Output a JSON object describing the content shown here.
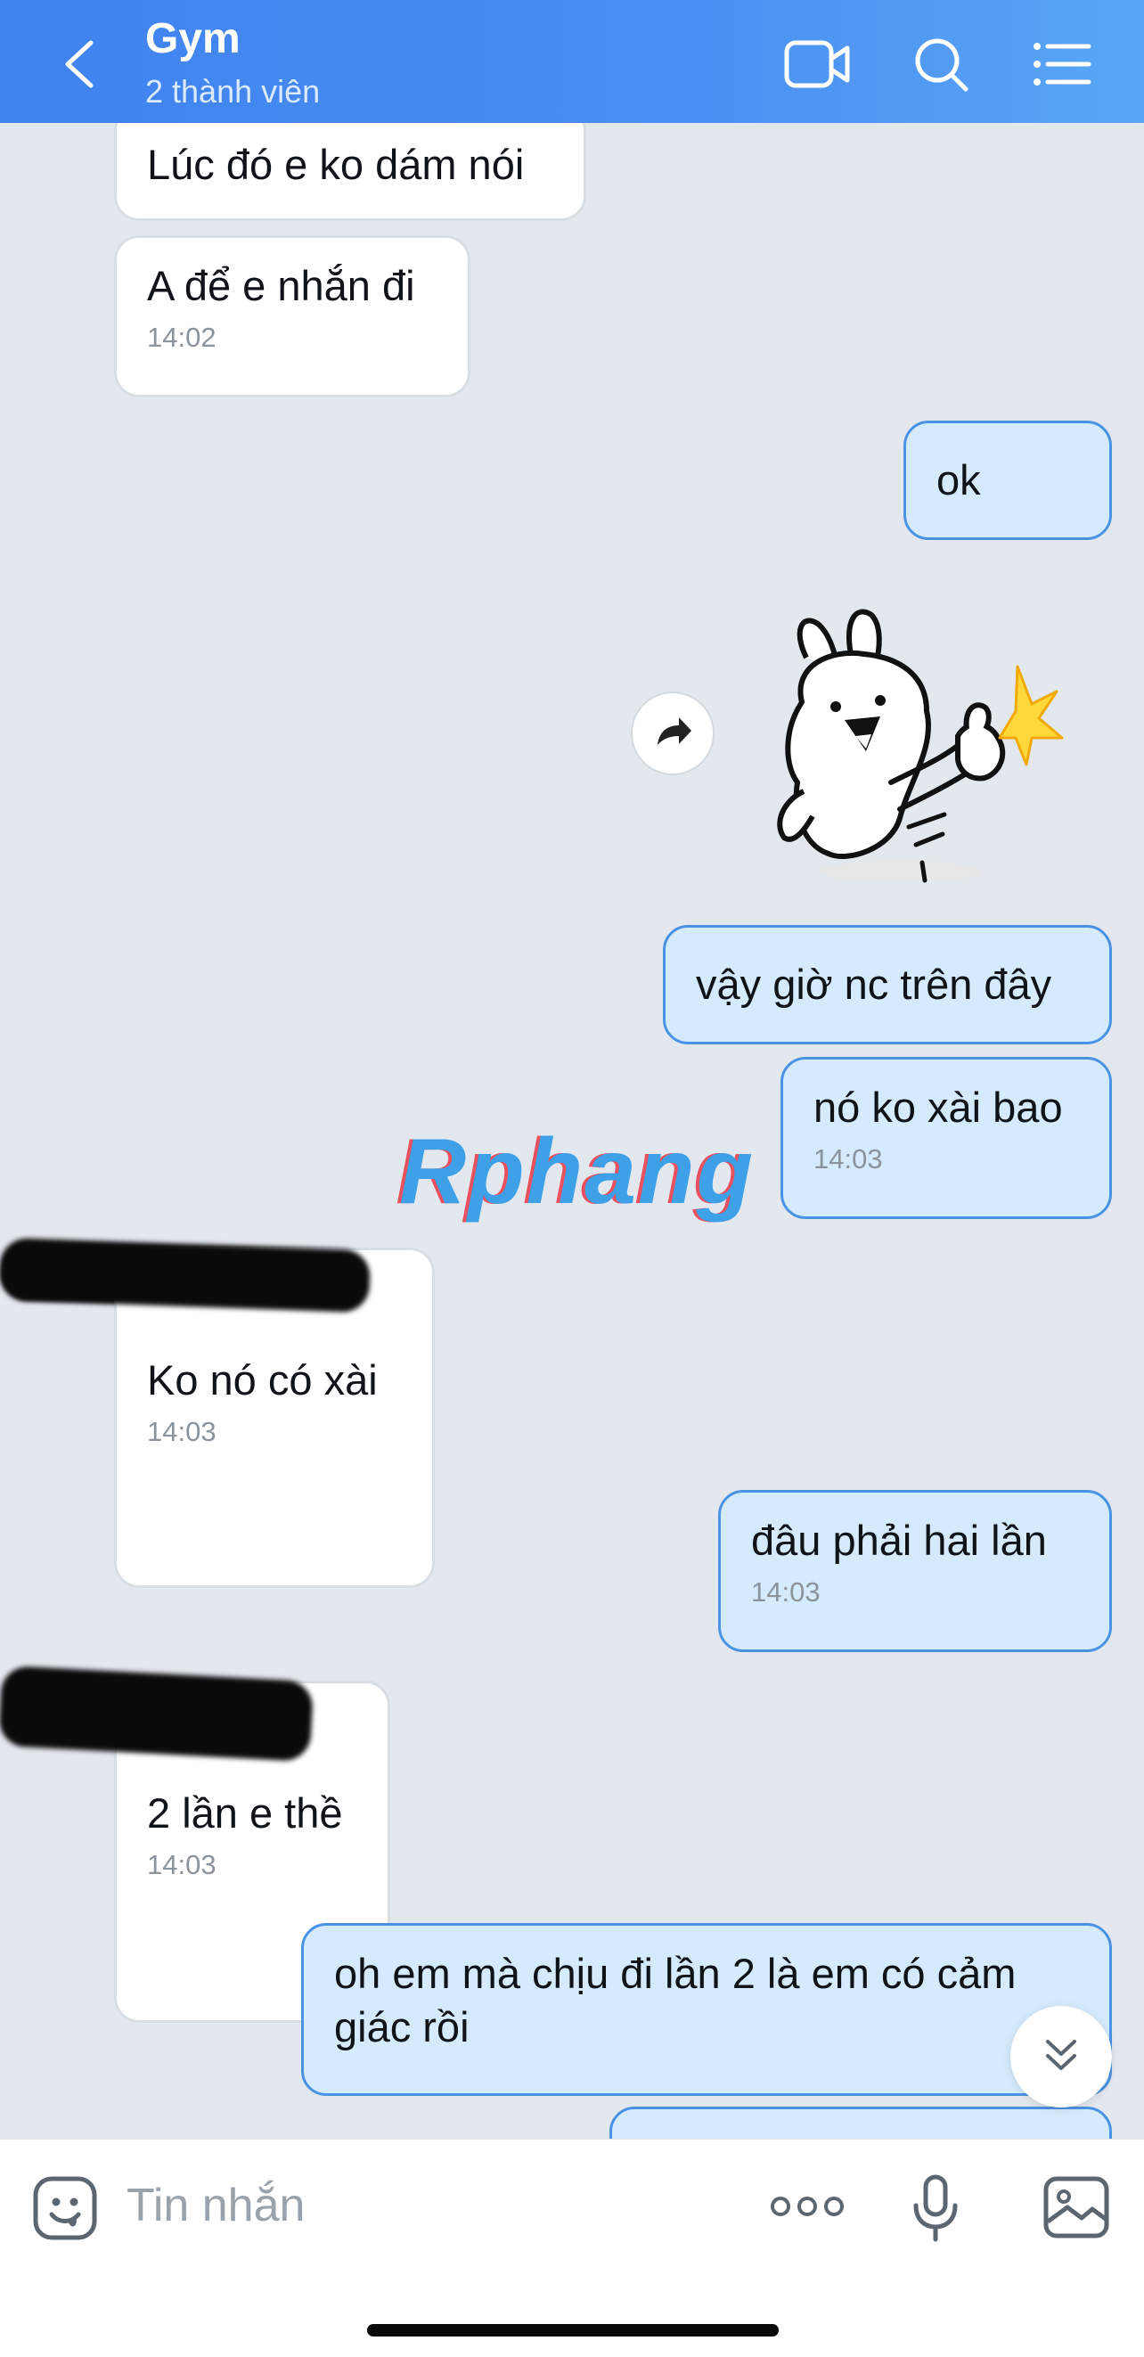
{
  "header": {
    "title": "Gym",
    "subtitle": "2 thành viên"
  },
  "messages": [
    {
      "text": "Lúc đó e ko dám nói",
      "time": ""
    },
    {
      "text": "A để e nhắn đi",
      "time": "14:02"
    },
    {
      "text": "ok",
      "time": ""
    },
    {
      "text": "vậy giờ nc trên đây",
      "time": ""
    },
    {
      "text": "nó ko xài bao",
      "time": "14:03"
    },
    {
      "text": "Ko nó có xài",
      "time": "14:03"
    },
    {
      "text": "đâu phải hai lần",
      "time": "14:03"
    },
    {
      "text": "2 lần e thề",
      "time": "14:03"
    },
    {
      "text": "oh em mà chịu đi lần 2 là em có cảm giác rồi",
      "time": ""
    }
  ],
  "sticker": {
    "name": "thumbs-up-rabbit-sticker"
  },
  "watermark": "Rphang",
  "input": {
    "placeholder": "Tin nhắn"
  },
  "icons": {
    "back": "chevron-left-icon",
    "video": "video-call-icon",
    "search": "search-icon",
    "menu": "list-menu-icon",
    "emoji": "emoji-icon",
    "more": "more-dots-icon",
    "mic": "microphone-icon",
    "image": "image-icon",
    "share": "forward-icon",
    "scroll": "double-chevron-down-icon"
  },
  "colors": {
    "header": "#4a8ff2",
    "outgoing_bubble": "#d5ebfd",
    "outgoing_border": "#4a93e4",
    "incoming_bubble": "#ffffff",
    "background": "#e3e8ef"
  }
}
